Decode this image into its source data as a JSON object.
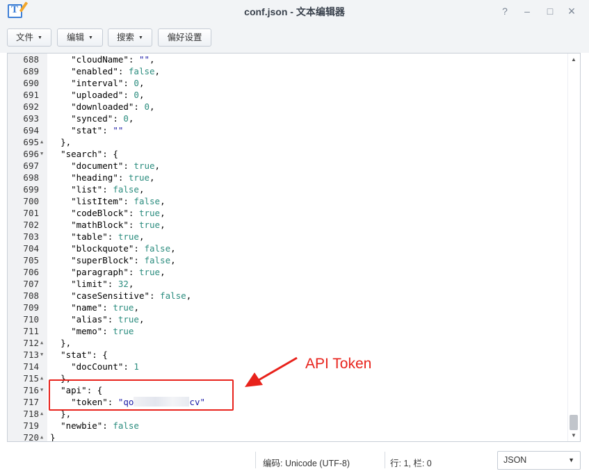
{
  "window": {
    "title": "conf.json - 文本编辑器",
    "help_icon": "?",
    "minimize_icon": "‒",
    "maximize_icon": "□",
    "close_icon": "×"
  },
  "toolbar": {
    "file_label": "文件",
    "edit_label": "编辑",
    "search_label": "搜索",
    "prefs_label": "偏好设置"
  },
  "editor": {
    "lines": [
      {
        "n": "688",
        "fold": "",
        "indent": 4,
        "parts": [
          [
            "p",
            "\""
          ],
          [
            "s",
            ""
          ],
          [
            "p",
            "cloudName\": "
          ],
          [
            "s",
            "\"\""
          ],
          [
            "p",
            ","
          ]
        ]
      },
      {
        "n": "689",
        "fold": "",
        "indent": 4,
        "parts": [
          [
            "p",
            "\"enabled\": "
          ],
          [
            "v",
            "false"
          ],
          [
            "p",
            ","
          ]
        ]
      },
      {
        "n": "690",
        "fold": "",
        "indent": 4,
        "parts": [
          [
            "p",
            "\"interval\": "
          ],
          [
            "v",
            "0"
          ],
          [
            "p",
            ","
          ]
        ]
      },
      {
        "n": "691",
        "fold": "",
        "indent": 4,
        "parts": [
          [
            "p",
            "\"uploaded\": "
          ],
          [
            "v",
            "0"
          ],
          [
            "p",
            ","
          ]
        ]
      },
      {
        "n": "692",
        "fold": "",
        "indent": 4,
        "parts": [
          [
            "p",
            "\"downloaded\": "
          ],
          [
            "v",
            "0"
          ],
          [
            "p",
            ","
          ]
        ]
      },
      {
        "n": "693",
        "fold": "",
        "indent": 4,
        "parts": [
          [
            "p",
            "\"synced\": "
          ],
          [
            "v",
            "0"
          ],
          [
            "p",
            ","
          ]
        ]
      },
      {
        "n": "694",
        "fold": "",
        "indent": 4,
        "parts": [
          [
            "p",
            "\"stat\": "
          ],
          [
            "s",
            "\"\""
          ]
        ]
      },
      {
        "n": "695",
        "fold": "▲",
        "indent": 2,
        "parts": [
          [
            "p",
            "},"
          ]
        ]
      },
      {
        "n": "696",
        "fold": "▼",
        "indent": 2,
        "parts": [
          [
            "p",
            "\"search\": {"
          ]
        ]
      },
      {
        "n": "697",
        "fold": "",
        "indent": 4,
        "parts": [
          [
            "p",
            "\"document\": "
          ],
          [
            "v",
            "true"
          ],
          [
            "p",
            ","
          ]
        ]
      },
      {
        "n": "698",
        "fold": "",
        "indent": 4,
        "parts": [
          [
            "p",
            "\"heading\": "
          ],
          [
            "v",
            "true"
          ],
          [
            "p",
            ","
          ]
        ]
      },
      {
        "n": "699",
        "fold": "",
        "indent": 4,
        "parts": [
          [
            "p",
            "\"list\": "
          ],
          [
            "v",
            "false"
          ],
          [
            "p",
            ","
          ]
        ]
      },
      {
        "n": "700",
        "fold": "",
        "indent": 4,
        "parts": [
          [
            "p",
            "\"listItem\": "
          ],
          [
            "v",
            "false"
          ],
          [
            "p",
            ","
          ]
        ]
      },
      {
        "n": "701",
        "fold": "",
        "indent": 4,
        "parts": [
          [
            "p",
            "\"codeBlock\": "
          ],
          [
            "v",
            "true"
          ],
          [
            "p",
            ","
          ]
        ]
      },
      {
        "n": "702",
        "fold": "",
        "indent": 4,
        "parts": [
          [
            "p",
            "\"mathBlock\": "
          ],
          [
            "v",
            "true"
          ],
          [
            "p",
            ","
          ]
        ]
      },
      {
        "n": "703",
        "fold": "",
        "indent": 4,
        "parts": [
          [
            "p",
            "\"table\": "
          ],
          [
            "v",
            "true"
          ],
          [
            "p",
            ","
          ]
        ]
      },
      {
        "n": "704",
        "fold": "",
        "indent": 4,
        "parts": [
          [
            "p",
            "\"blockquote\": "
          ],
          [
            "v",
            "false"
          ],
          [
            "p",
            ","
          ]
        ]
      },
      {
        "n": "705",
        "fold": "",
        "indent": 4,
        "parts": [
          [
            "p",
            "\"superBlock\": "
          ],
          [
            "v",
            "false"
          ],
          [
            "p",
            ","
          ]
        ]
      },
      {
        "n": "706",
        "fold": "",
        "indent": 4,
        "parts": [
          [
            "p",
            "\"paragraph\": "
          ],
          [
            "v",
            "true"
          ],
          [
            "p",
            ","
          ]
        ]
      },
      {
        "n": "707",
        "fold": "",
        "indent": 4,
        "parts": [
          [
            "p",
            "\"limit\": "
          ],
          [
            "v",
            "32"
          ],
          [
            "p",
            ","
          ]
        ]
      },
      {
        "n": "708",
        "fold": "",
        "indent": 4,
        "parts": [
          [
            "p",
            "\"caseSensitive\": "
          ],
          [
            "v",
            "false"
          ],
          [
            "p",
            ","
          ]
        ]
      },
      {
        "n": "709",
        "fold": "",
        "indent": 4,
        "parts": [
          [
            "p",
            "\"name\": "
          ],
          [
            "v",
            "true"
          ],
          [
            "p",
            ","
          ]
        ]
      },
      {
        "n": "710",
        "fold": "",
        "indent": 4,
        "parts": [
          [
            "p",
            "\"alias\": "
          ],
          [
            "v",
            "true"
          ],
          [
            "p",
            ","
          ]
        ]
      },
      {
        "n": "711",
        "fold": "",
        "indent": 4,
        "parts": [
          [
            "p",
            "\"memo\": "
          ],
          [
            "v",
            "true"
          ]
        ]
      },
      {
        "n": "712",
        "fold": "▲",
        "indent": 2,
        "parts": [
          [
            "p",
            "},"
          ]
        ]
      },
      {
        "n": "713",
        "fold": "▼",
        "indent": 2,
        "parts": [
          [
            "p",
            "\"stat\": {"
          ]
        ]
      },
      {
        "n": "714",
        "fold": "",
        "indent": 4,
        "parts": [
          [
            "p",
            "\"docCount\": "
          ],
          [
            "v",
            "1"
          ]
        ]
      },
      {
        "n": "715",
        "fold": "▲",
        "indent": 2,
        "parts": [
          [
            "p",
            "},"
          ]
        ]
      },
      {
        "n": "716",
        "fold": "▼",
        "indent": 2,
        "parts": [
          [
            "p",
            "\"api\": {"
          ]
        ]
      },
      {
        "n": "717",
        "fold": "",
        "indent": 4,
        "parts": [
          [
            "p",
            "\"token\": "
          ],
          [
            "s",
            "\"qo"
          ],
          [
            "r",
            ""
          ],
          [
            "s",
            "cv\""
          ]
        ]
      },
      {
        "n": "718",
        "fold": "▲",
        "indent": 2,
        "parts": [
          [
            "p",
            "},"
          ]
        ]
      },
      {
        "n": "719",
        "fold": "",
        "indent": 2,
        "parts": [
          [
            "p",
            "\"newbie\": "
          ],
          [
            "v",
            "false"
          ]
        ]
      },
      {
        "n": "720",
        "fold": "▲",
        "indent": 0,
        "parts": [
          [
            "p",
            "}"
          ]
        ]
      }
    ]
  },
  "annotation": {
    "label": "API Token",
    "color": "#e8221b"
  },
  "statusbar": {
    "encoding": "编码: Unicode (UTF-8)",
    "position": "行: 1, 栏: 0",
    "language": "JSON"
  }
}
